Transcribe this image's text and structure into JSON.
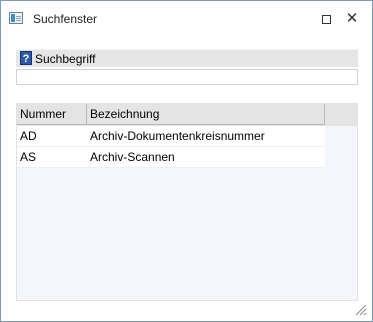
{
  "window": {
    "title": "Suchfenster",
    "maximize_icon": "maximize-icon",
    "close_icon": "close-icon",
    "close_glyph": "✕"
  },
  "search": {
    "label": "Suchbegriff",
    "help_icon": "help-icon",
    "help_glyph": "?",
    "value": "",
    "placeholder": ""
  },
  "results": {
    "columns": [
      "Nummer",
      "Bezeichnung"
    ],
    "rows": [
      {
        "nummer": "AD",
        "bezeichnung": "Archiv-Dokumentenkreisnummer"
      },
      {
        "nummer": "AS",
        "bezeichnung": "Archiv-Scannen"
      }
    ]
  },
  "colors": {
    "header_background": "#e4e4e4",
    "help_icon_background": "#2c5ca8",
    "list_background": "#f5f6fb"
  }
}
